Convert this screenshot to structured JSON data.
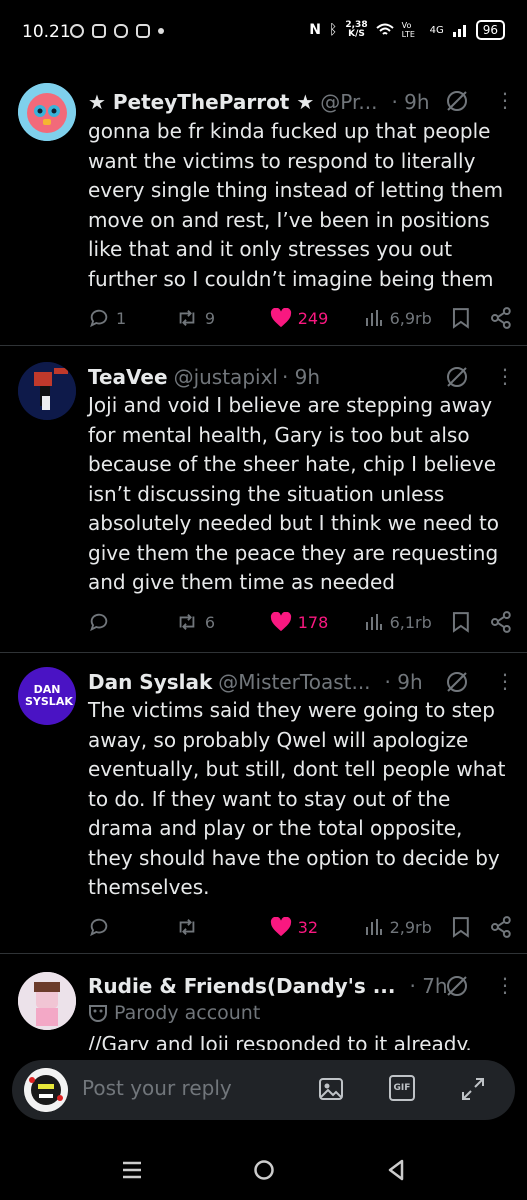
{
  "status": {
    "time": "10.21",
    "net_speed": "2,38",
    "net_unit": "K/S",
    "volte": "Vo LTE",
    "signal": "4G",
    "battery": "96"
  },
  "tweets": [
    {
      "name": "★ PeteyTheParrot ★",
      "handle": "@Pr...",
      "time": "· 9h",
      "text": "gonna be fr kinda fucked up that people want the victims to respond to literally every single thing instead of letting them move on and rest, I’ve been in positions like that and it only stresses you out further so I couldn’t imagine being them",
      "replies": "1",
      "retweets": "9",
      "likes": "249",
      "views": "6,9rb"
    },
    {
      "name": "TeaVee",
      "handle": "@justapixl",
      "time": "· 9h",
      "text": "Joji and void I believe are stepping away for mental health, Gary is too but also because of the sheer hate, chip I believe isn’t discussing the situation unless absolutely needed but I think we need to give them the peace they are requesting and give them time as needed",
      "replies": "",
      "retweets": "6",
      "likes": "178",
      "views": "6,1rb"
    },
    {
      "name": "Dan Syslak",
      "handle": "@MisterToast...",
      "time": "· 9h",
      "text": "The victims said they were going to step away, so probably Qwel will apologize eventually, but still, dont tell people what to do. If they want to stay out of the drama and play or the total opposite, they should have the option to decide by themselves.",
      "replies": "",
      "retweets": "",
      "likes": "32",
      "views": "2,9rb",
      "avatar_text": "DAN SYSLAK"
    },
    {
      "name": "Rudie & Friends(Dandy's ...",
      "handle": "",
      "time": "· 7h",
      "parody_label": "Parody account",
      "text": "//Gary and Joji responded to it already."
    }
  ],
  "reply": {
    "placeholder": "Post your reply",
    "gif_label": "GIF"
  },
  "colors": {
    "background": "#000000",
    "like": "#f91880",
    "muted": "#71767b"
  }
}
